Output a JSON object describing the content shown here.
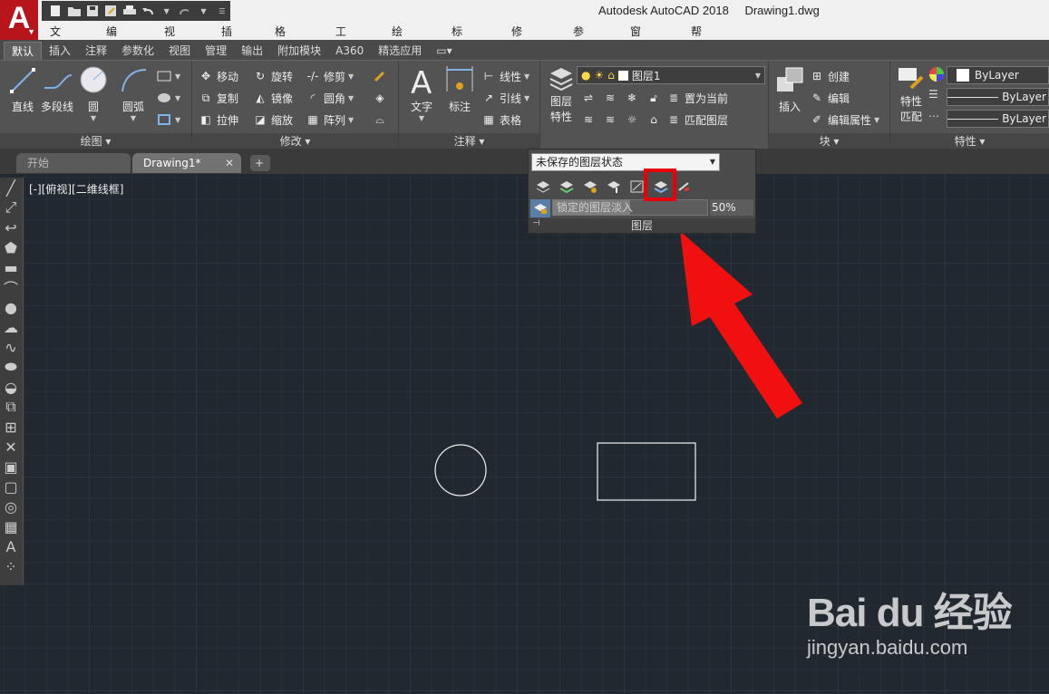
{
  "window": {
    "app_title": "Autodesk AutoCAD 2018",
    "file_name": "Drawing1.dwg",
    "logo_letter": "A"
  },
  "menu": [
    "文件(F)",
    "编辑(E)",
    "视图(V)",
    "插入(I)",
    "格式(O)",
    "工具(T)",
    "绘图(D)",
    "标注(N)",
    "修改(M)",
    "参数(P)",
    "窗口(W)",
    "帮助(H)"
  ],
  "ribbon_tabs": [
    "默认",
    "插入",
    "注释",
    "参数化",
    "视图",
    "管理",
    "输出",
    "附加模块",
    "A360",
    "精选应用"
  ],
  "ribbon": {
    "draw_panel": {
      "title": "绘图",
      "line": "直线",
      "polyline": "多段线",
      "circle": "圆",
      "arc": "圆弧"
    },
    "modify_panel": {
      "title": "修改",
      "move": "移动",
      "rotate": "旋转",
      "trim": "修剪",
      "copy": "复制",
      "mirror": "镜像",
      "fillet": "圆角",
      "stretch": "拉伸",
      "scale": "缩放",
      "array": "阵列"
    },
    "annotation_panel": {
      "title": "注释",
      "text": "文字",
      "dimension": "标注",
      "linear": "线性",
      "leader": "引线",
      "table": "表格"
    },
    "layers_panel": {
      "layer_props_1": "图层",
      "layer_props_2": "特性",
      "current_layer": "图层1",
      "set_current": "置为当前",
      "match_layer": "匹配图层"
    },
    "block_panel": {
      "title": "块",
      "insert": "插入",
      "create": "创建",
      "edit": "编辑",
      "edit_attr": "编辑属性"
    },
    "properties_panel": {
      "title": "特性",
      "match_1": "特性",
      "match_2": "匹配",
      "color": "ByLayer",
      "linetype": "ByLayer",
      "lineweight": "ByLayer"
    }
  },
  "doc_tabs": {
    "start": "开始",
    "drawing": "Drawing1*",
    "close": "✕",
    "add": "+"
  },
  "viewport_label": "[-][俯视][二维线框]",
  "layer_dropdown": {
    "state": "未保存的图层状态",
    "fade_label": "锁定的图层淡入",
    "fade_value": "50%",
    "fade_fraction": 0.5,
    "footer": "图层"
  },
  "watermark": {
    "brand": "Bai du 经验",
    "url": "jingyan.baidu.com"
  },
  "colors": {
    "highlight": "#e8000b",
    "arrow": "#f01010",
    "canvas_bg": "#212830"
  }
}
